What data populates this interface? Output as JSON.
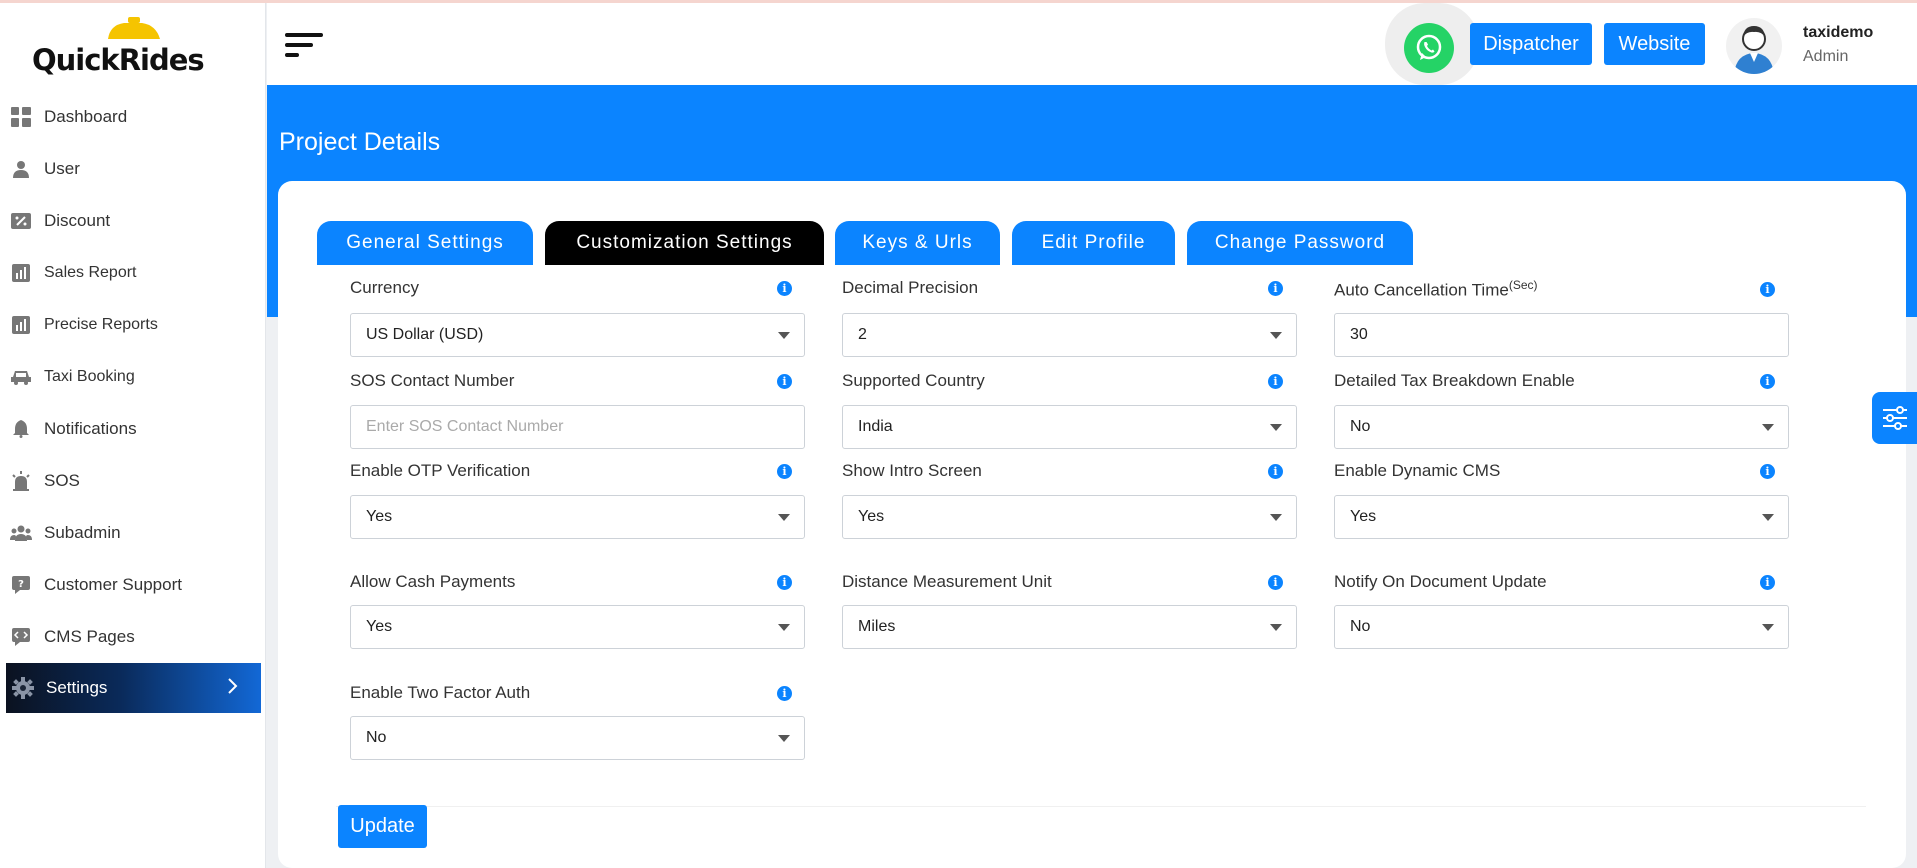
{
  "app": {
    "logo_text": "QuickRides"
  },
  "sidebar": {
    "items": [
      {
        "label": "Dashboard",
        "icon": "dashboard-icon"
      },
      {
        "label": "User",
        "icon": "user-icon"
      },
      {
        "label": "Discount",
        "icon": "discount-icon"
      },
      {
        "label": "Sales Report",
        "icon": "report-icon"
      },
      {
        "label": "Precise Reports",
        "icon": "report-icon"
      },
      {
        "label": "Taxi Booking",
        "icon": "car-icon"
      },
      {
        "label": "Notifications",
        "icon": "bell-icon"
      },
      {
        "label": "SOS",
        "icon": "alarm-icon"
      },
      {
        "label": "Subadmin",
        "icon": "group-icon"
      },
      {
        "label": "Customer Support",
        "icon": "support-icon"
      },
      {
        "label": "CMS Pages",
        "icon": "code-icon"
      },
      {
        "label": "Settings",
        "icon": "gear-icon",
        "active": true
      }
    ]
  },
  "header": {
    "dispatcher_label": "Dispatcher",
    "website_label": "Website",
    "user_name": "taxidemo",
    "user_role": "Admin"
  },
  "page": {
    "title": "Project Details"
  },
  "tabs": [
    {
      "label": "General Settings"
    },
    {
      "label": "Customization Settings",
      "active": true
    },
    {
      "label": "Keys & Urls"
    },
    {
      "label": "Edit Profile"
    },
    {
      "label": "Change Password"
    }
  ],
  "form": {
    "currency": {
      "label": "Currency",
      "value": "US Dollar (USD)"
    },
    "decimal_precision": {
      "label": "Decimal Precision",
      "value": "2"
    },
    "auto_cancel": {
      "label": "Auto Cancellation Time",
      "sup": "(Sec)",
      "value": "30"
    },
    "sos_contact": {
      "label": "SOS Contact Number",
      "placeholder": "Enter SOS Contact Number"
    },
    "supported_country": {
      "label": "Supported Country",
      "value": "India"
    },
    "tax_breakdown": {
      "label": "Detailed Tax Breakdown Enable",
      "value": "No"
    },
    "otp": {
      "label": "Enable OTP Verification",
      "value": "Yes"
    },
    "intro_screen": {
      "label": "Show Intro Screen",
      "value": "Yes"
    },
    "dynamic_cms": {
      "label": "Enable Dynamic CMS",
      "value": "Yes"
    },
    "cash_payments": {
      "label": "Allow Cash Payments",
      "value": "Yes"
    },
    "distance_unit": {
      "label": "Distance Measurement Unit",
      "value": "Miles"
    },
    "notify_doc": {
      "label": "Notify On Document Update",
      "value": "No"
    },
    "two_factor": {
      "label": "Enable Two Factor Auth",
      "value": "No"
    },
    "info_glyph": "i",
    "update_label": "Update"
  },
  "colors": {
    "primary": "#0b84ff",
    "active_tab": "#000000",
    "whatsapp": "#25d366"
  }
}
